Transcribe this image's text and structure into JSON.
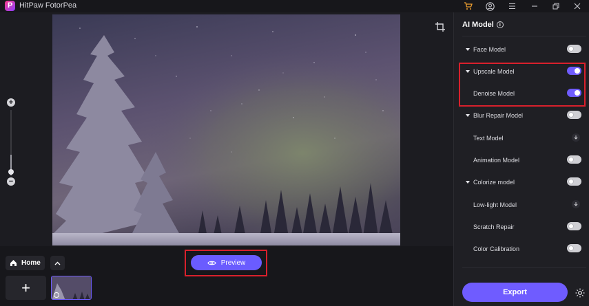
{
  "app": {
    "title": "HitPaw FotorPea",
    "logo_letter": "P"
  },
  "titlebar_icons": [
    "cart-icon",
    "account-icon",
    "menu-icon",
    "minimize-icon",
    "restore-icon",
    "close-icon"
  ],
  "canvas": {
    "zoom_level": 0.3
  },
  "bottom": {
    "home_label": "Home",
    "add_label": "+",
    "preview_label": "Preview"
  },
  "panel": {
    "title": "AI Model",
    "models": [
      {
        "label": "Face Model",
        "expandable": true,
        "control": "toggle",
        "on": false
      },
      {
        "label": "Upscale Model",
        "expandable": true,
        "control": "toggle",
        "on": true
      },
      {
        "label": "Denoise Model",
        "expandable": false,
        "control": "toggle",
        "on": true
      },
      {
        "label": "Blur Repair Model",
        "expandable": true,
        "control": "toggle",
        "on": false
      },
      {
        "label": "Text Model",
        "expandable": false,
        "control": "download"
      },
      {
        "label": "Animation Model",
        "expandable": false,
        "control": "toggle",
        "on": false
      },
      {
        "label": "Colorize model",
        "expandable": true,
        "control": "toggle",
        "on": false
      },
      {
        "label": "Low-light Model",
        "expandable": false,
        "control": "download"
      },
      {
        "label": "Scratch Repair",
        "expandable": false,
        "control": "toggle",
        "on": false
      },
      {
        "label": "Color Calibration",
        "expandable": false,
        "control": "toggle",
        "on": false
      }
    ],
    "export_label": "Export"
  },
  "colors": {
    "accent": "#6f5cff",
    "highlight": "#d9202c",
    "panel_bg": "#1f1f24"
  }
}
